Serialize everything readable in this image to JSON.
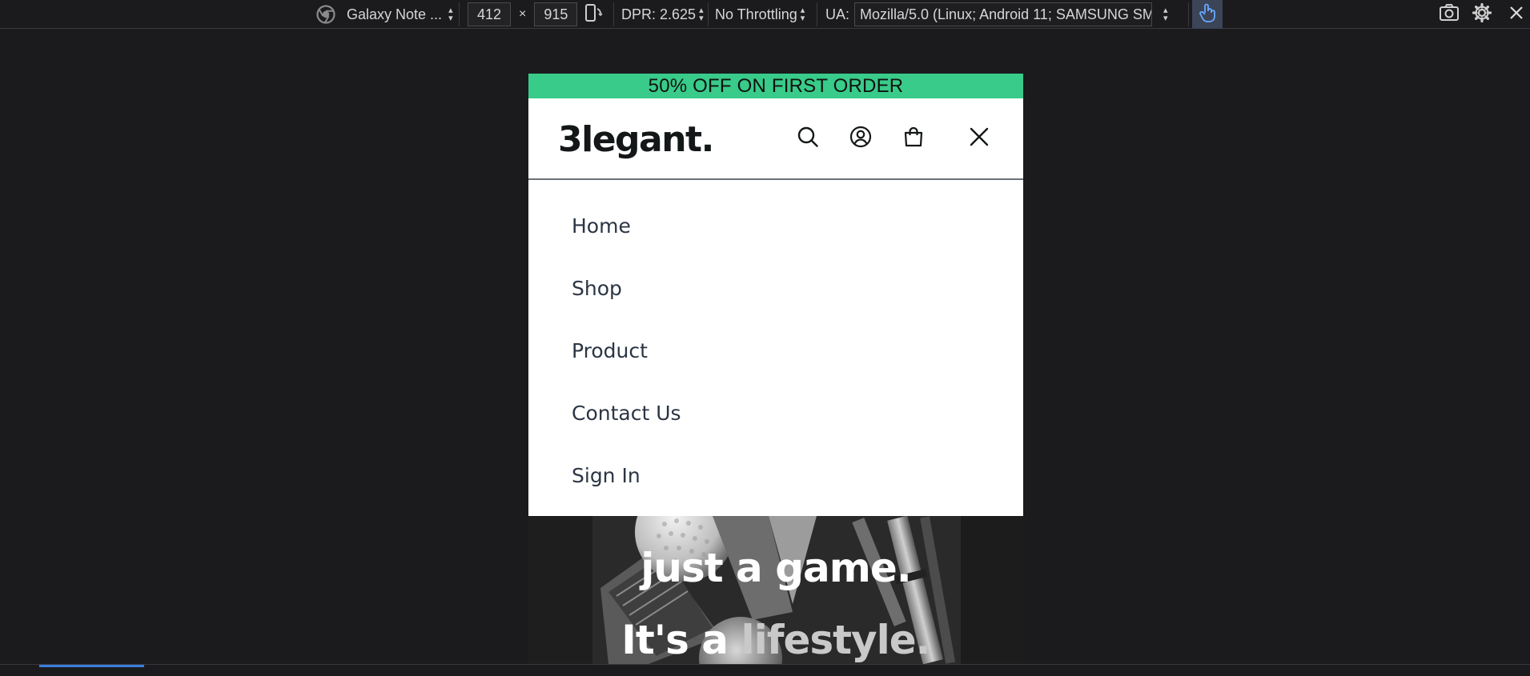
{
  "devtools": {
    "device_name": "Galaxy Note ...",
    "width": "412",
    "times": "×",
    "height": "915",
    "dpr": "DPR: 2.625",
    "throttling": "No Throttling",
    "ua_label": "UA:",
    "ua_value": "Mozilla/5.0 (Linux; Android 11; SAMSUNG SM-",
    "icons": [
      "chrome-icon",
      "rotate-icon",
      "touch-icon",
      "screenshot-icon",
      "settings-icon",
      "close-icon"
    ]
  },
  "site": {
    "promo": "50% OFF ON FIRST ORDER",
    "logo": "3legant.",
    "header_icons": [
      "search-icon",
      "user-icon",
      "bag-icon",
      "close-icon"
    ],
    "menu": [
      {
        "label": "Home"
      },
      {
        "label": "Shop"
      },
      {
        "label": "Product"
      },
      {
        "label": "Contact Us"
      },
      {
        "label": "Sign In"
      }
    ],
    "hero": {
      "line1": "just a game.",
      "line2_start": "It's a ",
      "line2_end": "lifestyle."
    }
  },
  "colors": {
    "accent_green": "#38cb89",
    "devtools_bg": "#1b1b1e",
    "text_dark": "#141718",
    "touch_active": "#3b4557"
  }
}
